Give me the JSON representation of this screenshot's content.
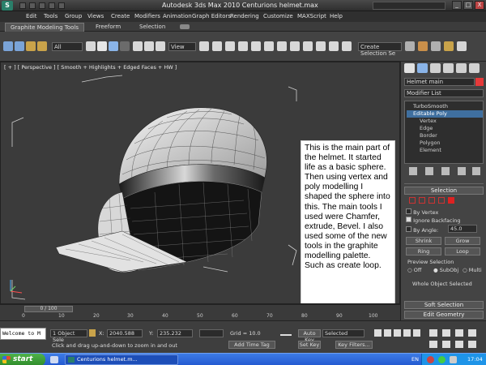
{
  "window": {
    "title": "Autodesk 3ds Max  2010    Centurions helmet.max",
    "logo": "3ds-max-logo",
    "controls": [
      "_",
      "□",
      "X"
    ]
  },
  "menu": [
    "Edit",
    "Tools",
    "Group",
    "Views",
    "Create",
    "Modifiers",
    "Animation",
    "Graph Editors",
    "Rendering",
    "Customize",
    "MAXScript",
    "Help"
  ],
  "ribbon": {
    "tabs": [
      "Graphite Modeling Tools",
      "Freeform",
      "Selection"
    ]
  },
  "toolbar": {
    "filter_select": "All",
    "view_select": "View",
    "named_selection_placeholder": "Create Selection Se"
  },
  "viewport": {
    "label": "[ + ] [ Perspective ] [ Smooth + Highlights + Edged Faces + HW ]",
    "note": "This is the main part of the helmet. It started life as a basic sphere. Then using vertex and poly modelling I shaped the sphere into this. The main tools I used were Chamfer, extrude, Bevel. I also used some of the new tools in the graphite modelling palette.  Such as create loop."
  },
  "command_panel": {
    "object_name": "Helmet main",
    "object_color": "#e63a3a",
    "modifier_list": "Modifier List",
    "stack": [
      {
        "label": "TurboSmooth",
        "level": 0,
        "selected": false
      },
      {
        "label": "Editable Poly",
        "level": 0,
        "selected": true
      },
      {
        "label": "Vertex",
        "level": 1,
        "selected": false
      },
      {
        "label": "Edge",
        "level": 1,
        "selected": false
      },
      {
        "label": "Border",
        "level": 1,
        "selected": false
      },
      {
        "label": "Polygon",
        "level": 1,
        "selected": false
      },
      {
        "label": "Element",
        "level": 1,
        "selected": false
      }
    ],
    "selection": {
      "header": "Selection",
      "by_vertex": "By Vertex",
      "ignore_backfacing": "Ignore Backfacing",
      "by_angle": "By Angle:",
      "angle_value": "45.0",
      "shrink": "Shrink",
      "grow": "Grow",
      "ring": "Ring",
      "loop": "Loop",
      "preview_selection": "Preview Selection",
      "preview_off": "Off",
      "preview_subobj": "SubObj",
      "preview_multi": "Multi",
      "whole_object": "Whole Object Selected"
    },
    "soft_selection": "Soft Selection",
    "edit_geometry": "Edit Geometry"
  },
  "timeline": {
    "slider": "0 / 100",
    "ticks": [
      "0",
      "10",
      "20",
      "30",
      "40",
      "50",
      "60",
      "70",
      "80",
      "90",
      "100"
    ]
  },
  "status": {
    "maxscript": "Welcome to M",
    "selection": "1 Object Sele",
    "x_label": "X:",
    "x_value": "2040.588",
    "y_label": "Y:",
    "y_value": "235.232",
    "grid": "Grid = 10.0",
    "auto_key": "Auto Key",
    "selected": "Selected",
    "set_key": "Set Key",
    "key_filters": "Key Filters...",
    "prompt": "Click and drag up-and-down to zoom in and out",
    "add_time_tag": "Add Time Tag"
  },
  "taskbar": {
    "start": "start",
    "task": "Centurions helmet.m...",
    "lang": "EN",
    "clock": "17:04"
  }
}
